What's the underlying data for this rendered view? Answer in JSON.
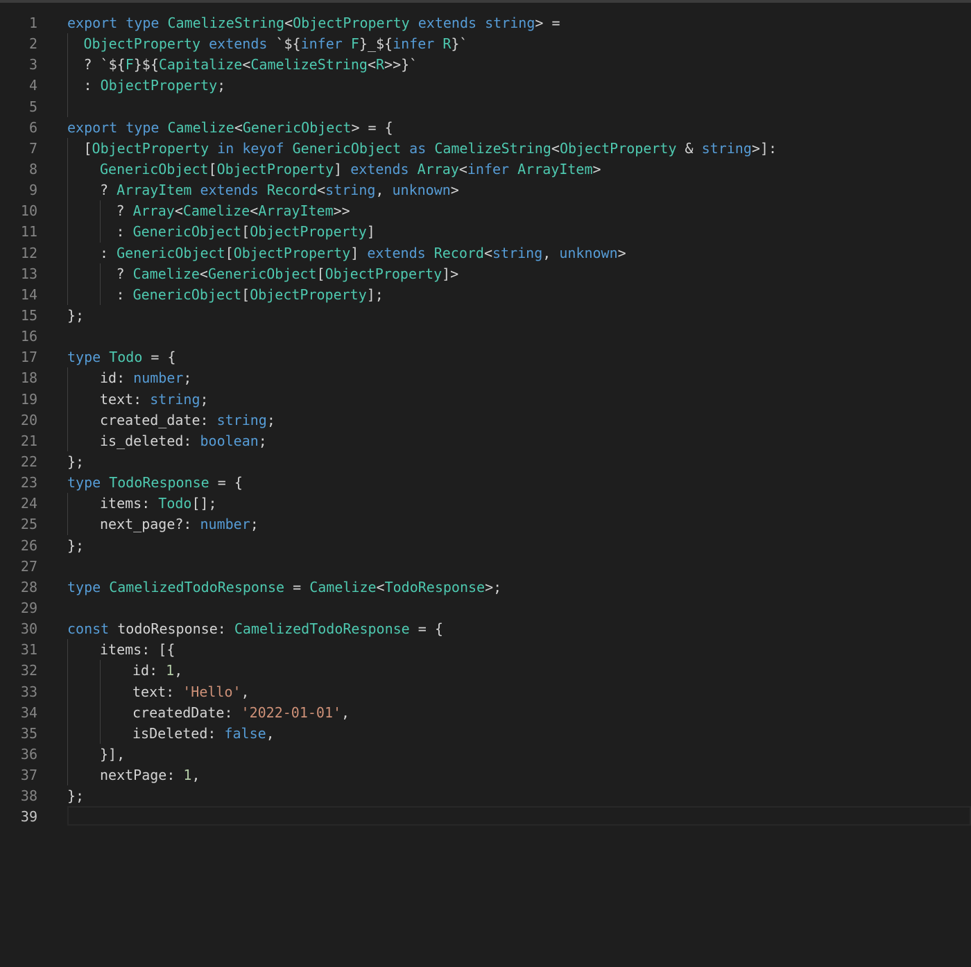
{
  "editor": {
    "language": "typescript",
    "active_line": 39,
    "colors": {
      "background": "#1e1e1e",
      "keyword": "#569cd6",
      "type": "#4ec9b0",
      "string": "#ce9178",
      "number": "#b5cea8",
      "text": "#d4d4d4",
      "line_number": "#858585"
    },
    "lines": [
      {
        "n": "1",
        "indent": 0,
        "tokens": [
          [
            "kw",
            "export"
          ],
          [
            "tx",
            " "
          ],
          [
            "kw",
            "type"
          ],
          [
            "tx",
            " "
          ],
          [
            "ty",
            "CamelizeString"
          ],
          [
            "tx",
            "<"
          ],
          [
            "ty",
            "ObjectProperty"
          ],
          [
            "tx",
            " "
          ],
          [
            "kw",
            "extends"
          ],
          [
            "tx",
            " "
          ],
          [
            "kw",
            "string"
          ],
          [
            "tx",
            "> ="
          ]
        ]
      },
      {
        "n": "2",
        "indent": 1,
        "tokens": [
          [
            "ty",
            "ObjectProperty"
          ],
          [
            "tx",
            " "
          ],
          [
            "kw",
            "extends"
          ],
          [
            "tx",
            " `${"
          ],
          [
            "kw",
            "infer"
          ],
          [
            "tx",
            " "
          ],
          [
            "ty",
            "F"
          ],
          [
            "tx",
            "}_${"
          ],
          [
            "kw",
            "infer"
          ],
          [
            "tx",
            " "
          ],
          [
            "ty",
            "R"
          ],
          [
            "tx",
            "}`"
          ]
        ]
      },
      {
        "n": "3",
        "indent": 1,
        "tokens": [
          [
            "tx",
            "? `${"
          ],
          [
            "ty",
            "F"
          ],
          [
            "tx",
            "}${"
          ],
          [
            "ty",
            "Capitalize"
          ],
          [
            "tx",
            "<"
          ],
          [
            "ty",
            "CamelizeString"
          ],
          [
            "tx",
            "<"
          ],
          [
            "ty",
            "R"
          ],
          [
            "tx",
            ">>}`"
          ]
        ]
      },
      {
        "n": "4",
        "indent": 1,
        "tokens": [
          [
            "tx",
            ": "
          ],
          [
            "ty",
            "ObjectProperty"
          ],
          [
            "tx",
            ";"
          ]
        ]
      },
      {
        "n": "5",
        "indent": 1,
        "tokens": []
      },
      {
        "n": "6",
        "indent": 0,
        "tokens": [
          [
            "kw",
            "export"
          ],
          [
            "tx",
            " "
          ],
          [
            "kw",
            "type"
          ],
          [
            "tx",
            " "
          ],
          [
            "ty",
            "Camelize"
          ],
          [
            "tx",
            "<"
          ],
          [
            "ty",
            "GenericObject"
          ],
          [
            "tx",
            "> = {"
          ]
        ]
      },
      {
        "n": "7",
        "indent": 1,
        "tokens": [
          [
            "tx",
            "["
          ],
          [
            "ty",
            "ObjectProperty"
          ],
          [
            "tx",
            " "
          ],
          [
            "kw",
            "in"
          ],
          [
            "tx",
            " "
          ],
          [
            "kw",
            "keyof"
          ],
          [
            "tx",
            " "
          ],
          [
            "ty",
            "GenericObject"
          ],
          [
            "tx",
            " "
          ],
          [
            "kw",
            "as"
          ],
          [
            "tx",
            " "
          ],
          [
            "ty",
            "CamelizeString"
          ],
          [
            "tx",
            "<"
          ],
          [
            "ty",
            "ObjectProperty"
          ],
          [
            "tx",
            " & "
          ],
          [
            "kw",
            "string"
          ],
          [
            "tx",
            ">]:"
          ]
        ]
      },
      {
        "n": "8",
        "indent": 2,
        "tokens": [
          [
            "ty",
            "GenericObject"
          ],
          [
            "tx",
            "["
          ],
          [
            "ty",
            "ObjectProperty"
          ],
          [
            "tx",
            "] "
          ],
          [
            "kw",
            "extends"
          ],
          [
            "tx",
            " "
          ],
          [
            "ty",
            "Array"
          ],
          [
            "tx",
            "<"
          ],
          [
            "kw",
            "infer"
          ],
          [
            "tx",
            " "
          ],
          [
            "ty",
            "ArrayItem"
          ],
          [
            "tx",
            ">"
          ]
        ]
      },
      {
        "n": "9",
        "indent": 2,
        "tokens": [
          [
            "tx",
            "? "
          ],
          [
            "ty",
            "ArrayItem"
          ],
          [
            "tx",
            " "
          ],
          [
            "kw",
            "extends"
          ],
          [
            "tx",
            " "
          ],
          [
            "ty",
            "Record"
          ],
          [
            "tx",
            "<"
          ],
          [
            "kw",
            "string"
          ],
          [
            "tx",
            ", "
          ],
          [
            "kw",
            "unknown"
          ],
          [
            "tx",
            ">"
          ]
        ]
      },
      {
        "n": "10",
        "indent": 3,
        "tokens": [
          [
            "tx",
            "? "
          ],
          [
            "ty",
            "Array"
          ],
          [
            "tx",
            "<"
          ],
          [
            "ty",
            "Camelize"
          ],
          [
            "tx",
            "<"
          ],
          [
            "ty",
            "ArrayItem"
          ],
          [
            "tx",
            ">>"
          ]
        ]
      },
      {
        "n": "11",
        "indent": 3,
        "tokens": [
          [
            "tx",
            ": "
          ],
          [
            "ty",
            "GenericObject"
          ],
          [
            "tx",
            "["
          ],
          [
            "ty",
            "ObjectProperty"
          ],
          [
            "tx",
            "]"
          ]
        ]
      },
      {
        "n": "12",
        "indent": 2,
        "tokens": [
          [
            "tx",
            ": "
          ],
          [
            "ty",
            "GenericObject"
          ],
          [
            "tx",
            "["
          ],
          [
            "ty",
            "ObjectProperty"
          ],
          [
            "tx",
            "] "
          ],
          [
            "kw",
            "extends"
          ],
          [
            "tx",
            " "
          ],
          [
            "ty",
            "Record"
          ],
          [
            "tx",
            "<"
          ],
          [
            "kw",
            "string"
          ],
          [
            "tx",
            ", "
          ],
          [
            "kw",
            "unknown"
          ],
          [
            "tx",
            ">"
          ]
        ]
      },
      {
        "n": "13",
        "indent": 3,
        "tokens": [
          [
            "tx",
            "? "
          ],
          [
            "ty",
            "Camelize"
          ],
          [
            "tx",
            "<"
          ],
          [
            "ty",
            "GenericObject"
          ],
          [
            "tx",
            "["
          ],
          [
            "ty",
            "ObjectProperty"
          ],
          [
            "tx",
            "]>"
          ]
        ]
      },
      {
        "n": "14",
        "indent": 3,
        "tokens": [
          [
            "tx",
            ": "
          ],
          [
            "ty",
            "GenericObject"
          ],
          [
            "tx",
            "["
          ],
          [
            "ty",
            "ObjectProperty"
          ],
          [
            "tx",
            "];"
          ]
        ]
      },
      {
        "n": "15",
        "indent": 0,
        "tokens": [
          [
            "tx",
            "};"
          ]
        ]
      },
      {
        "n": "16",
        "indent": 0,
        "tokens": []
      },
      {
        "n": "17",
        "indent": 0,
        "tokens": [
          [
            "kw",
            "type"
          ],
          [
            "tx",
            " "
          ],
          [
            "ty",
            "Todo"
          ],
          [
            "tx",
            " = {"
          ]
        ]
      },
      {
        "n": "18",
        "indent": 2,
        "tokens": [
          [
            "tx",
            "id: "
          ],
          [
            "kw",
            "number"
          ],
          [
            "tx",
            ";"
          ]
        ]
      },
      {
        "n": "19",
        "indent": 2,
        "tokens": [
          [
            "tx",
            "text: "
          ],
          [
            "kw",
            "string"
          ],
          [
            "tx",
            ";"
          ]
        ]
      },
      {
        "n": "20",
        "indent": 2,
        "tokens": [
          [
            "tx",
            "created_date: "
          ],
          [
            "kw",
            "string"
          ],
          [
            "tx",
            ";"
          ]
        ]
      },
      {
        "n": "21",
        "indent": 2,
        "tokens": [
          [
            "tx",
            "is_deleted: "
          ],
          [
            "kw",
            "boolean"
          ],
          [
            "tx",
            ";"
          ]
        ]
      },
      {
        "n": "22",
        "indent": 0,
        "tokens": [
          [
            "tx",
            "};"
          ]
        ]
      },
      {
        "n": "23",
        "indent": 0,
        "tokens": [
          [
            "kw",
            "type"
          ],
          [
            "tx",
            " "
          ],
          [
            "ty",
            "TodoResponse"
          ],
          [
            "tx",
            " = {"
          ]
        ]
      },
      {
        "n": "24",
        "indent": 2,
        "tokens": [
          [
            "tx",
            "items: "
          ],
          [
            "ty",
            "Todo"
          ],
          [
            "tx",
            "[];"
          ]
        ]
      },
      {
        "n": "25",
        "indent": 2,
        "tokens": [
          [
            "tx",
            "next_page?: "
          ],
          [
            "kw",
            "number"
          ],
          [
            "tx",
            ";"
          ]
        ]
      },
      {
        "n": "26",
        "indent": 0,
        "tokens": [
          [
            "tx",
            "};"
          ]
        ]
      },
      {
        "n": "27",
        "indent": 0,
        "tokens": []
      },
      {
        "n": "28",
        "indent": 0,
        "tokens": [
          [
            "kw",
            "type"
          ],
          [
            "tx",
            " "
          ],
          [
            "ty",
            "CamelizedTodoResponse"
          ],
          [
            "tx",
            " = "
          ],
          [
            "ty",
            "Camelize"
          ],
          [
            "tx",
            "<"
          ],
          [
            "ty",
            "TodoResponse"
          ],
          [
            "tx",
            ">;"
          ]
        ]
      },
      {
        "n": "29",
        "indent": 0,
        "tokens": []
      },
      {
        "n": "30",
        "indent": 0,
        "tokens": [
          [
            "kw",
            "const"
          ],
          [
            "tx",
            " todoResponse: "
          ],
          [
            "ty",
            "CamelizedTodoResponse"
          ],
          [
            "tx",
            " = {"
          ]
        ]
      },
      {
        "n": "31",
        "indent": 2,
        "tokens": [
          [
            "tx",
            "items: [{"
          ]
        ]
      },
      {
        "n": "32",
        "indent": 4,
        "tokens": [
          [
            "tx",
            "id: "
          ],
          [
            "nm",
            "1"
          ],
          [
            "tx",
            ","
          ]
        ]
      },
      {
        "n": "33",
        "indent": 4,
        "tokens": [
          [
            "tx",
            "text: "
          ],
          [
            "st",
            "'Hello'"
          ],
          [
            "tx",
            ","
          ]
        ]
      },
      {
        "n": "34",
        "indent": 4,
        "tokens": [
          [
            "tx",
            "createdDate: "
          ],
          [
            "st",
            "'2022-01-01'"
          ],
          [
            "tx",
            ","
          ]
        ]
      },
      {
        "n": "35",
        "indent": 4,
        "tokens": [
          [
            "tx",
            "isDeleted: "
          ],
          [
            "kw",
            "false"
          ],
          [
            "tx",
            ","
          ]
        ]
      },
      {
        "n": "36",
        "indent": 2,
        "tokens": [
          [
            "tx",
            "}],"
          ]
        ]
      },
      {
        "n": "37",
        "indent": 2,
        "tokens": [
          [
            "tx",
            "nextPage: "
          ],
          [
            "nm",
            "1"
          ],
          [
            "tx",
            ","
          ]
        ]
      },
      {
        "n": "38",
        "indent": 0,
        "tokens": [
          [
            "tx",
            "};"
          ]
        ]
      },
      {
        "n": "39",
        "indent": 0,
        "tokens": []
      }
    ]
  }
}
